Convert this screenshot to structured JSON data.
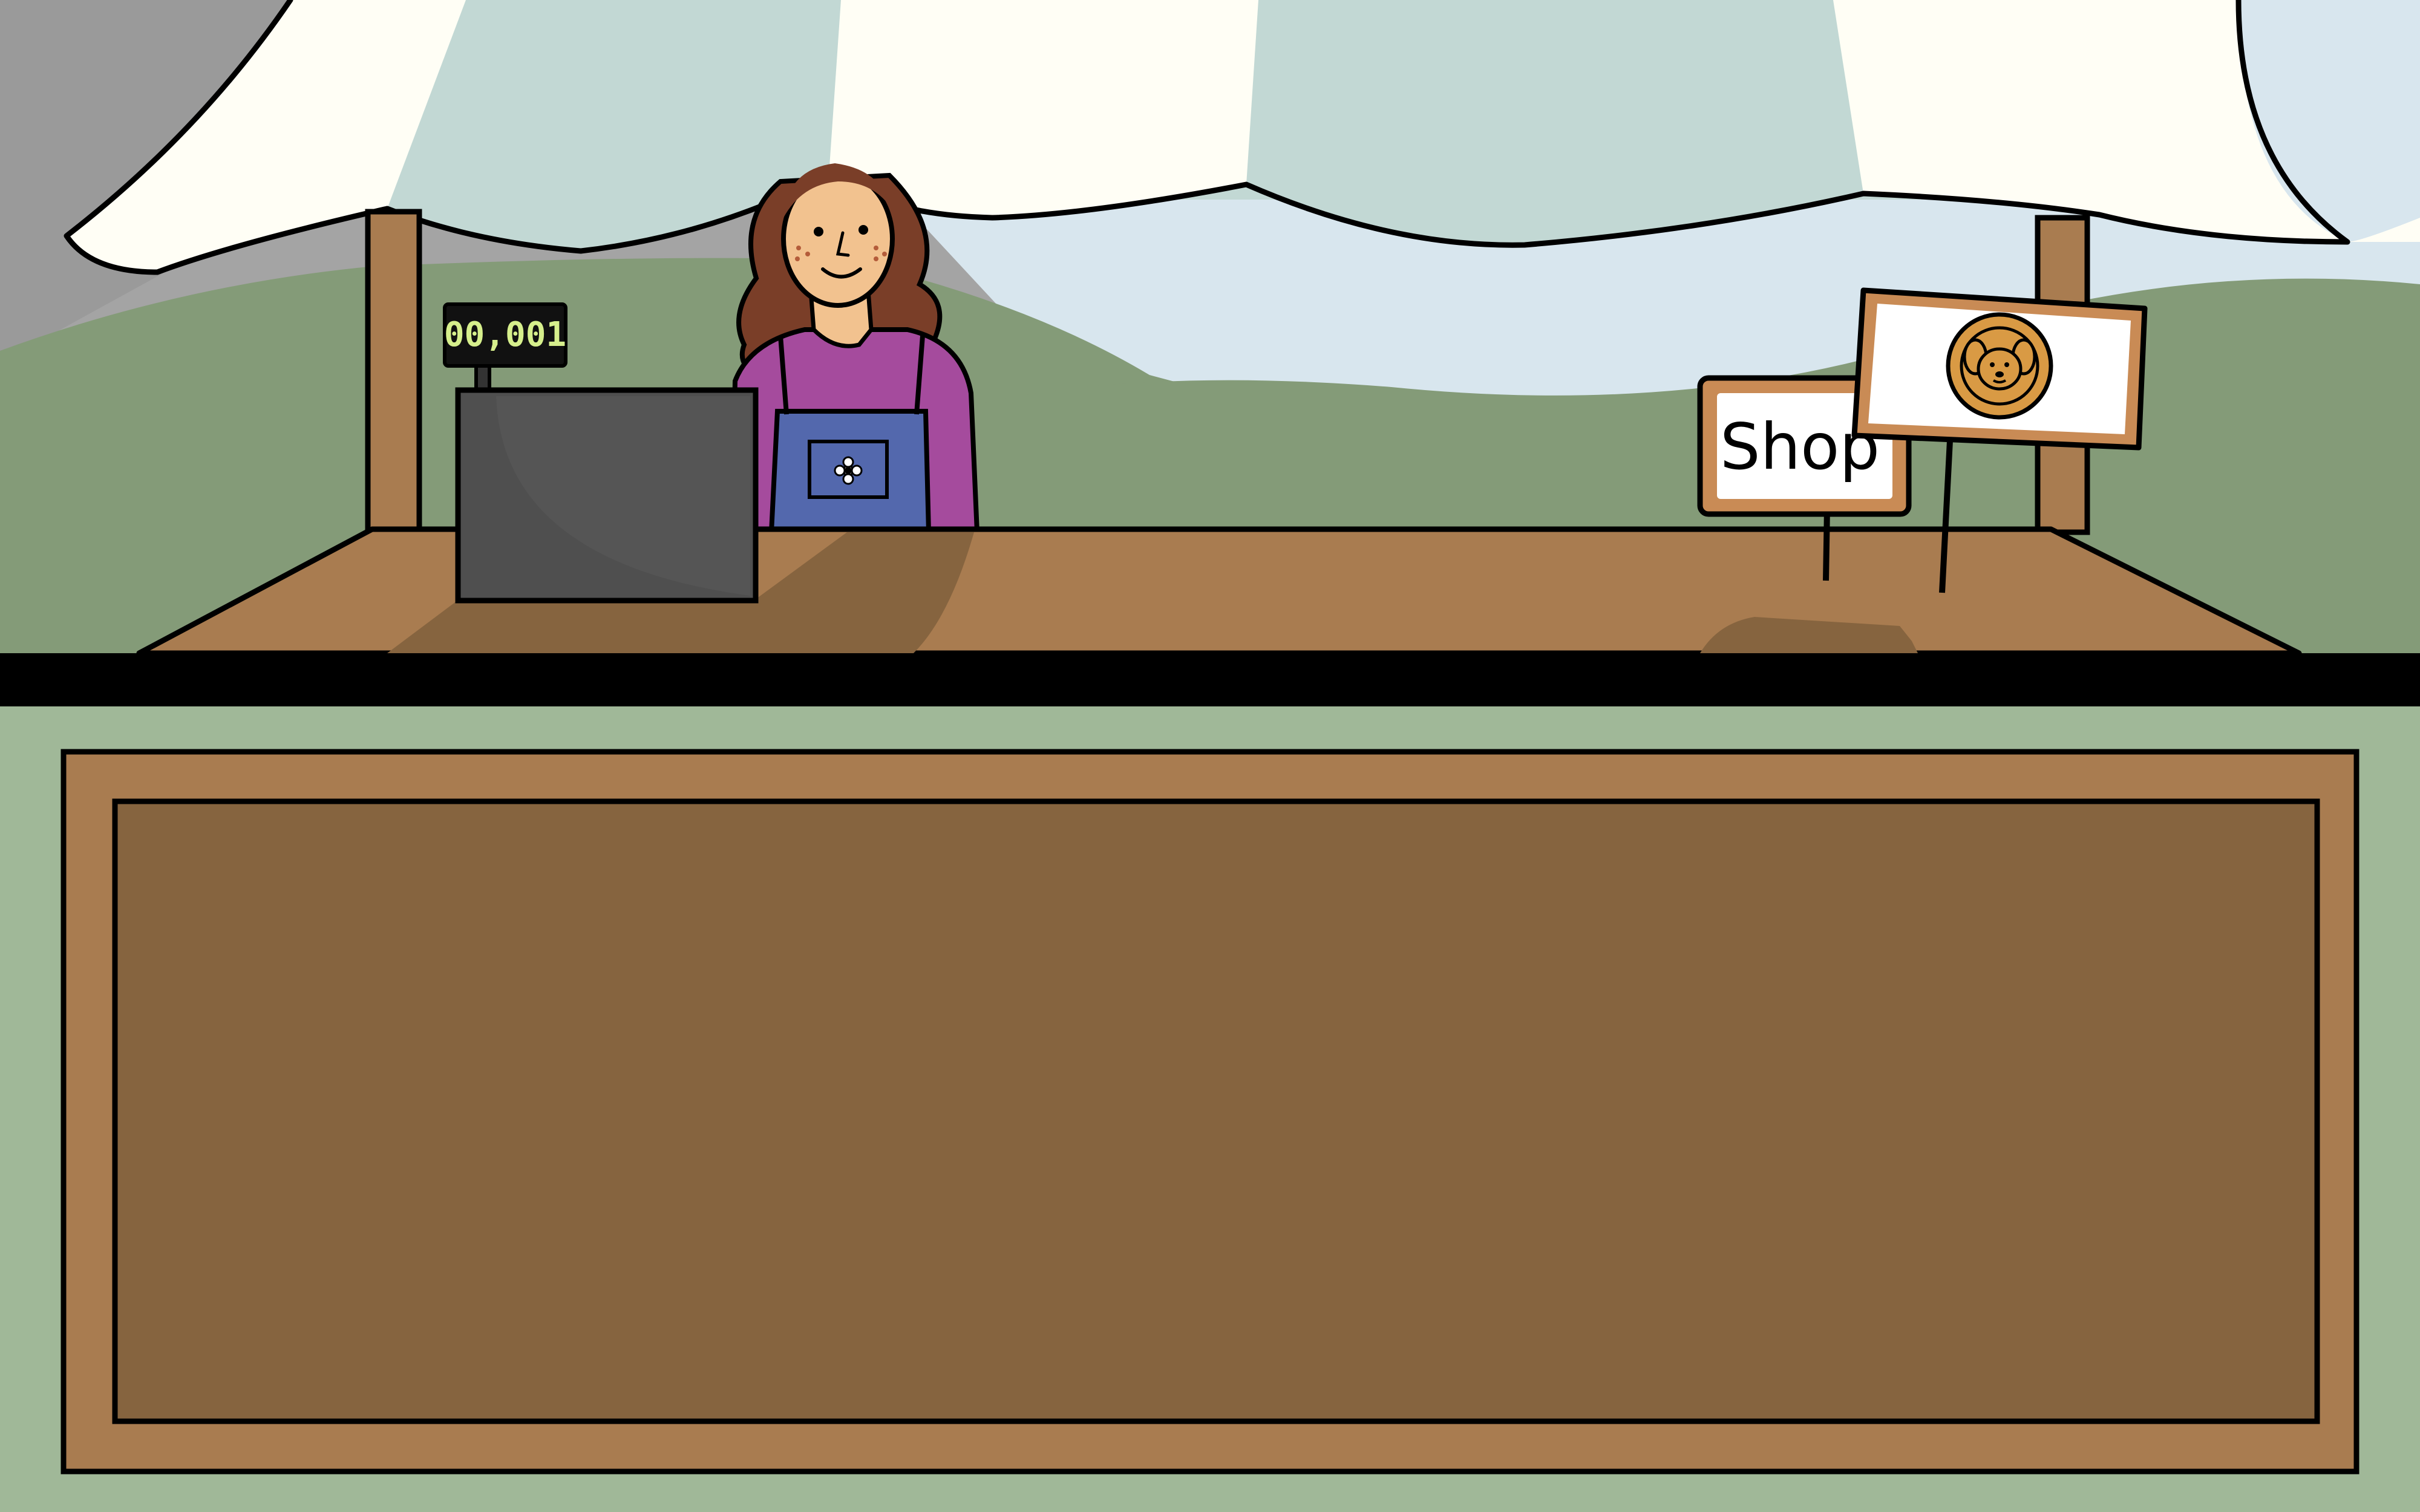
{
  "scene": {
    "register_display": "00,001",
    "shop_sign": "Shop"
  },
  "icons": {
    "brand_badge": "dog-face-icon",
    "apron_pocket": "flower-icon"
  },
  "colors": {
    "sky": "#d8e6ee",
    "hill": "#849b78",
    "awning": "#fffef5",
    "wood": "#a97c50",
    "wood_dark": "#86643f",
    "ground": "#a0b898",
    "register": "#4f4f4f",
    "display_text": "#d6ef8c",
    "sweater": "#a54b9d",
    "overalls": "#5368ad",
    "hair": "#7a3e28",
    "skin": "#f2c28f",
    "badge": "#d99a44"
  }
}
